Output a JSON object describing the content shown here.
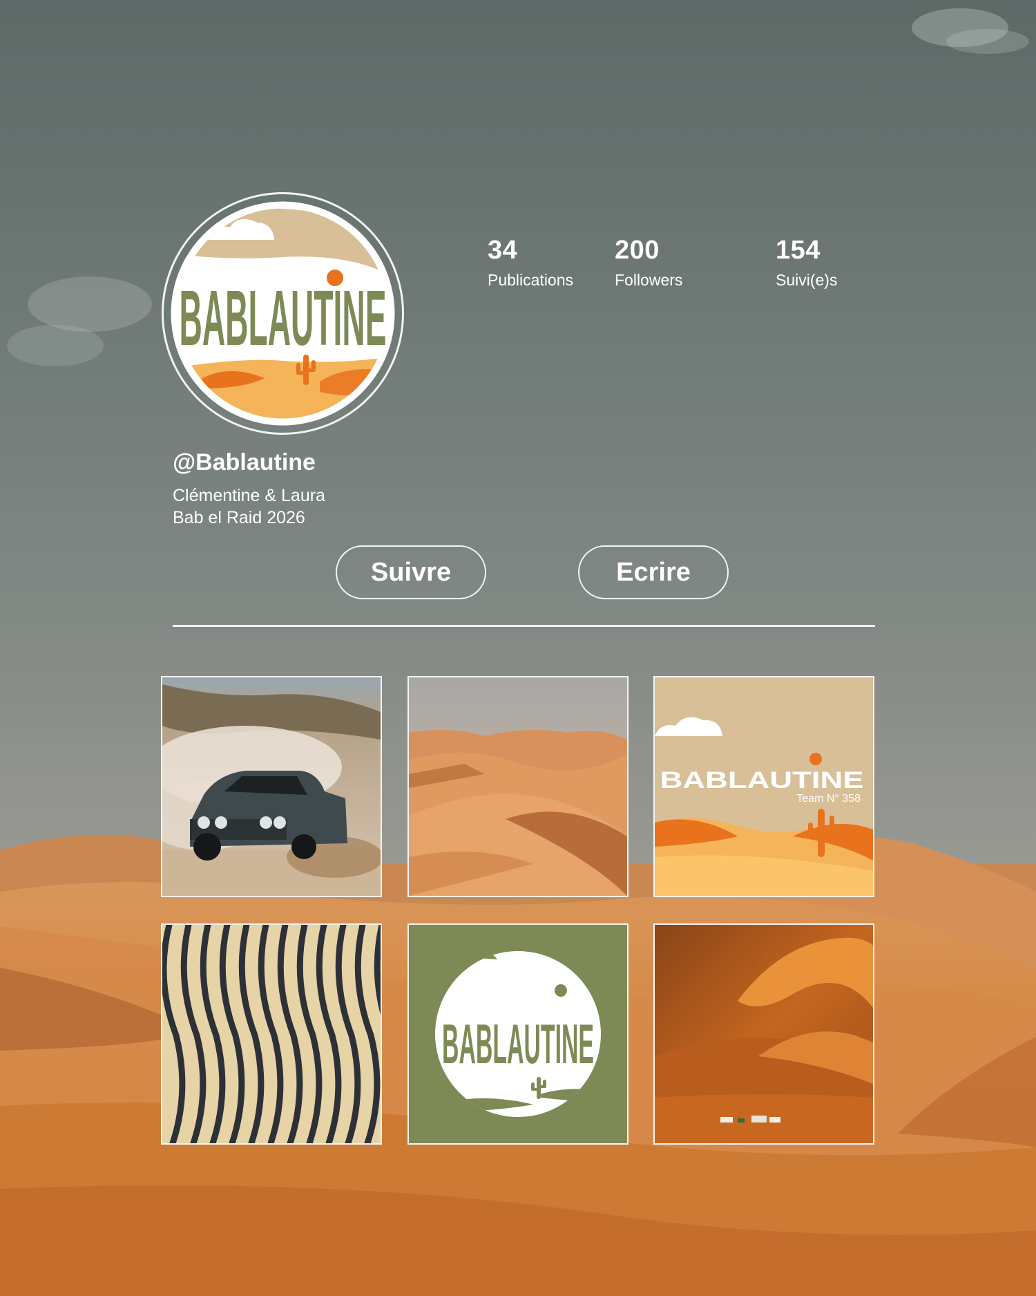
{
  "profile": {
    "handle": "@Bablautine",
    "bio_line1": "Clémentine & Laura",
    "bio_line2": "Bab el Raid 2026",
    "avatar_logo_text": "BABLAUTINE"
  },
  "stats": [
    {
      "value": "34",
      "label": "Publications"
    },
    {
      "value": "200",
      "label": "Followers"
    },
    {
      "value": "154",
      "label": "Suivi(e)s"
    }
  ],
  "actions": {
    "follow_label": "Suivre",
    "message_label": "Ecrire"
  },
  "posts": [
    {
      "name": "rally-car-photo",
      "kind": "photo"
    },
    {
      "name": "desert-dunes-photo",
      "kind": "photo"
    },
    {
      "name": "team-logo-card",
      "kind": "graphic",
      "logo_text": "BABLAUTINE",
      "caption": "Team N° 358"
    },
    {
      "name": "sand-ripples-photo",
      "kind": "photo"
    },
    {
      "name": "logo-green-card",
      "kind": "graphic",
      "logo_text": "BABLAUTINE"
    },
    {
      "name": "desert-camp-photo",
      "kind": "photo"
    }
  ],
  "colors": {
    "sky_top": "#5f6d6a",
    "sky_bottom": "#a3a09a",
    "sand": "#d98a3e",
    "sand_dark": "#b5602a",
    "olive": "#7e8a55",
    "logo_orange": "#e8731c",
    "logo_beige": "#d8bf98"
  }
}
